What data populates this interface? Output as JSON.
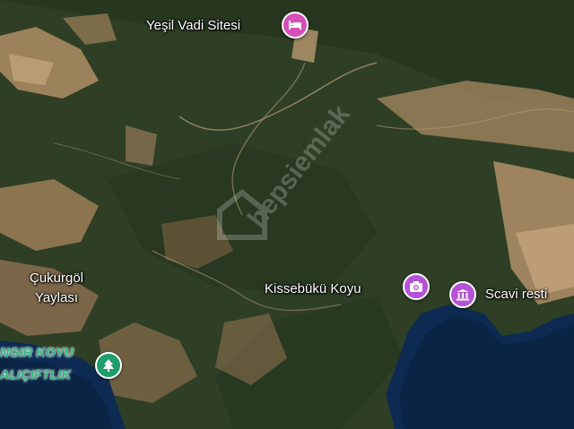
{
  "map": {
    "places": [
      {
        "label": "Yeşil Vadi Sitesi",
        "icon": "bed-icon",
        "color": "#d64fb8"
      },
      {
        "label": "Çukurgöl Yaylası",
        "icon": "none"
      },
      {
        "label": "Kissebükü Koyu",
        "icon": "camera-icon",
        "color": "#b552d6"
      },
      {
        "label": "Scavi resti",
        "icon": "museum-icon",
        "color": "#b552d6"
      },
      {
        "label": "NGIR KOYU ALIÇIFTLIK",
        "icon": "tree-icon",
        "color": "#1e9e6a"
      }
    ],
    "pois": {
      "hotel": {
        "label": "Yeşil Vadi Sitesi"
      },
      "upland": {
        "label": "Çukurgöl Yaylası"
      },
      "bay": {
        "label": "Kissebükü Koyu"
      },
      "ruins": {
        "label": "Scavi resti"
      },
      "park": {
        "line1": "NGIR KOYU",
        "line2": "ALIÇIFTLIK"
      }
    },
    "watermark": "hepsiemlak",
    "colors": {
      "forest": "#2e3f25",
      "sea": "#0d2b52",
      "bare_ground": "#a88a62"
    }
  }
}
